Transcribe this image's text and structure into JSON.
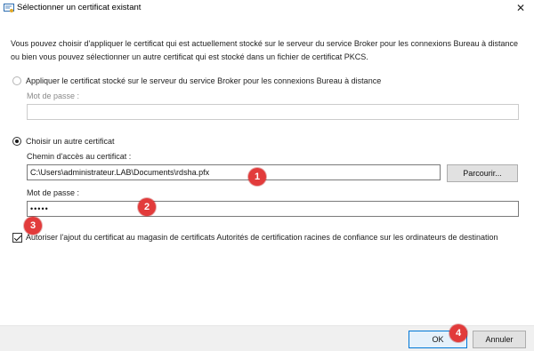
{
  "window": {
    "title": "Sélectionner un certificat existant",
    "close_glyph": "✕"
  },
  "intro": {
    "text": "Vous pouvez choisir d'appliquer le certificat qui est actuellement stocké sur le serveur du service Broker pour les connexions Bureau à distance ou bien vous pouvez sélectionner un autre certificat qui est stocké dans un fichier de certificat PKCS."
  },
  "option_apply": {
    "label": "Appliquer le certificat stocké sur le serveur du service Broker pour les connexions Bureau à distance",
    "selected": false,
    "password_label": "Mot de passe :",
    "password_value": ""
  },
  "option_other": {
    "label": "Choisir un autre certificat",
    "selected": true,
    "path_label": "Chemin d'accès au certificat :",
    "path_value": "C:\\Users\\administrateur.LAB\\Documents\\rdsha.pfx",
    "browse_label": "Parcourir...",
    "password_label": "Mot de passe :",
    "password_value": "•••••"
  },
  "trust_checkbox": {
    "checked": true,
    "label": "Autoriser l'ajout du certificat au magasin de certificats Autorités de certification racines de confiance sur les ordinateurs de destination"
  },
  "footer": {
    "ok_label": "OK",
    "cancel_label": "Annuler"
  },
  "annotations": [
    "1",
    "2",
    "3",
    "4"
  ],
  "colors": {
    "marker": "#e23b3b",
    "ok_border": "#0078d7",
    "footer_bg": "#f0f0f0"
  },
  "icons": {
    "window": "certificate-icon",
    "close": "close-icon"
  }
}
